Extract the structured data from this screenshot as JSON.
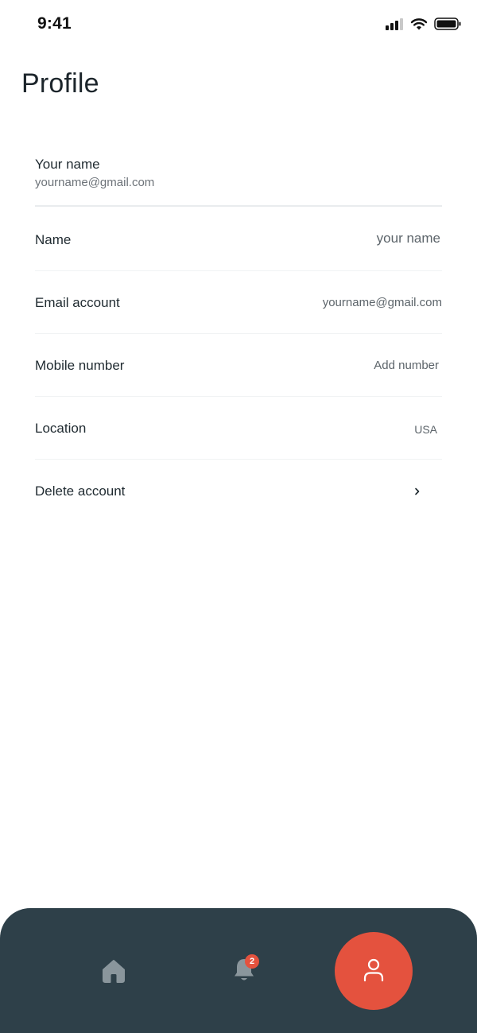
{
  "status_bar": {
    "time": "9:41",
    "icons": [
      "cellular-signal-icon",
      "wifi-icon",
      "battery-icon"
    ]
  },
  "page": {
    "title": "Profile"
  },
  "profile": {
    "name": "Your name",
    "email": "yourname@gmail.com"
  },
  "settings": {
    "items": [
      {
        "label": "Name",
        "value": "your name"
      },
      {
        "label": "Email account",
        "value": "yourname@gmail.com"
      },
      {
        "label": "Mobile number",
        "value": "Add number"
      },
      {
        "label": "Location",
        "value": "USA"
      },
      {
        "label": "Delete account",
        "value": "",
        "icon": "chevron-right-icon"
      }
    ]
  },
  "bottom_nav": {
    "items": [
      {
        "icon": "home-icon",
        "active": false
      },
      {
        "icon": "bell-icon",
        "badge": "2",
        "active": false
      },
      {
        "icon": "user-icon",
        "active": true
      }
    ],
    "colors": {
      "background": "#2e4049",
      "accent": "#e4523e",
      "inactive_icon": "#8a969c"
    }
  }
}
